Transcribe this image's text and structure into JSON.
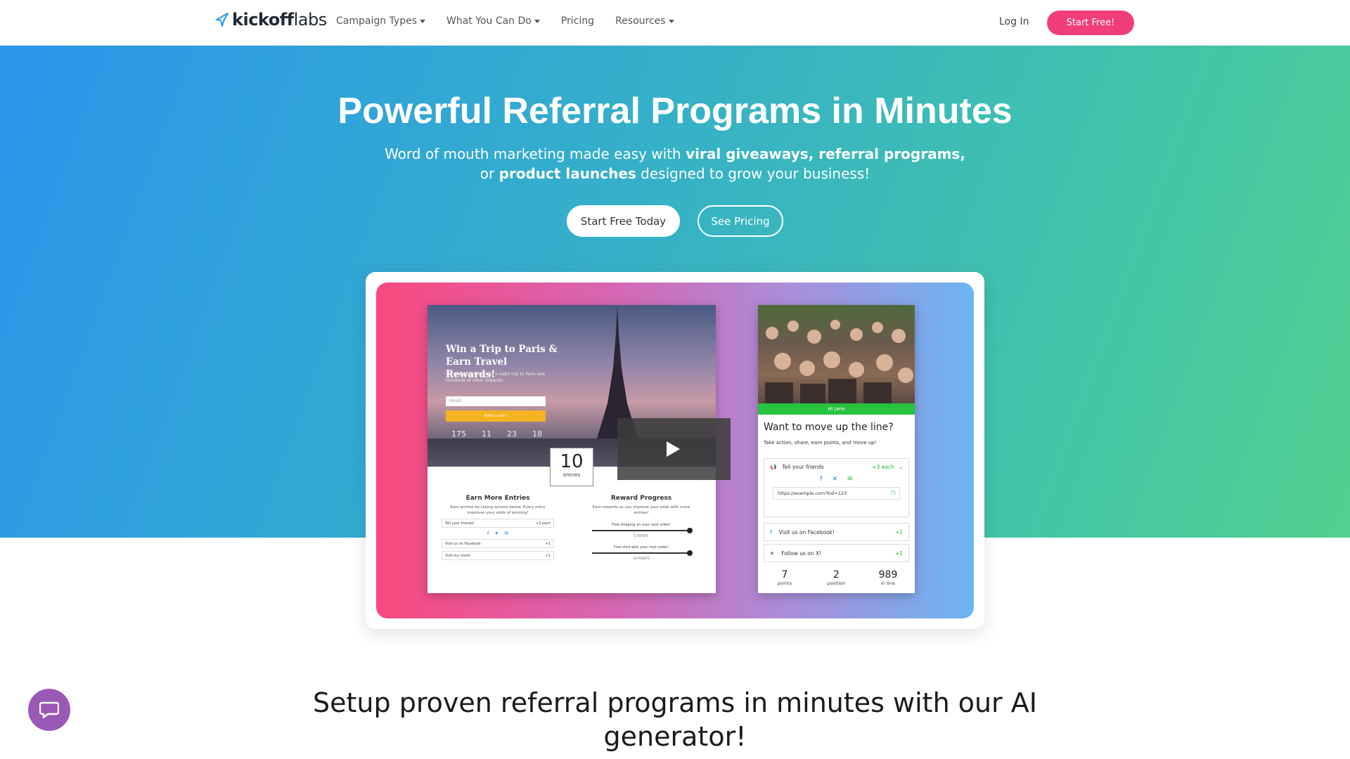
{
  "nav": {
    "brand_bold": "kickoff",
    "brand_light": "labs",
    "links": [
      {
        "label": "Campaign Types",
        "dropdown": true
      },
      {
        "label": "What You Can Do",
        "dropdown": true
      },
      {
        "label": "Pricing",
        "dropdown": false
      },
      {
        "label": "Resources",
        "dropdown": true
      }
    ],
    "login": "Log In",
    "cta": "Start Free!"
  },
  "hero": {
    "title": "Powerful Referral Programs in Minutes",
    "subtitle_parts": [
      {
        "text": "Word of mouth marketing made easy with ",
        "bold": false
      },
      {
        "text": "viral giveaways, referral programs,",
        "bold": true
      },
      {
        "text": " or ",
        "bold": false
      },
      {
        "text": "product launches",
        "bold": true
      },
      {
        "text": " designed to grow your business!",
        "bold": false
      }
    ],
    "primary_button": "Start Free Today",
    "secondary_button": "See Pricing"
  },
  "showcase": {
    "giveaway": {
      "title": "Win a Trip to Paris & Earn Travel Rewards!",
      "description": "We're giving away one 5-night trip to Paris and hundreds of other rewards!",
      "email_placeholder": "Email",
      "enter_button": "Enter to win!",
      "counts": [
        "175",
        "11",
        "23",
        "18"
      ],
      "entries_number": "10",
      "entries_label": "entries",
      "earn_heading": "Earn More Entries",
      "earn_desc": "Earn entries by taking actions below. Every entry improves your odds of winning!",
      "actions": [
        {
          "label": "Tell your friends!",
          "value": "+3 each"
        },
        {
          "label": "Visit us on Facebook",
          "value": "+1"
        },
        {
          "label": "Visit our store!",
          "value": "+1"
        }
      ],
      "reward_heading": "Reward Progress",
      "reward_desc": "Earn rewards as you improve your odds with more entries!",
      "rewards": [
        {
          "label": "Free shipping on your next order!",
          "points": "5 POINTS"
        },
        {
          "label": "Free shirt with your next order!",
          "points": "10 POINTS"
        }
      ]
    },
    "waitlist": {
      "greeting": "Hi Jane",
      "title": "Want to move up the line?",
      "subtitle": "Take action, share, earn points, and move up!",
      "share_label": "Tell your friends",
      "share_value": "+3 each",
      "url": "https://example.com?kid=123",
      "items": [
        {
          "label": "Visit us on Facebook!",
          "value": "+1"
        },
        {
          "label": "Follow us on X!",
          "value": "+1"
        }
      ],
      "stats": [
        {
          "value": "7",
          "label": "points"
        },
        {
          "value": "2",
          "label": "position"
        },
        {
          "value": "989",
          "label": "in line"
        }
      ]
    }
  },
  "section": {
    "title": "Setup proven referral programs in minutes with our AI generator!"
  },
  "colors": {
    "accent": "#f23d7c",
    "chat": "#9b59b6",
    "green": "#27c33f"
  }
}
